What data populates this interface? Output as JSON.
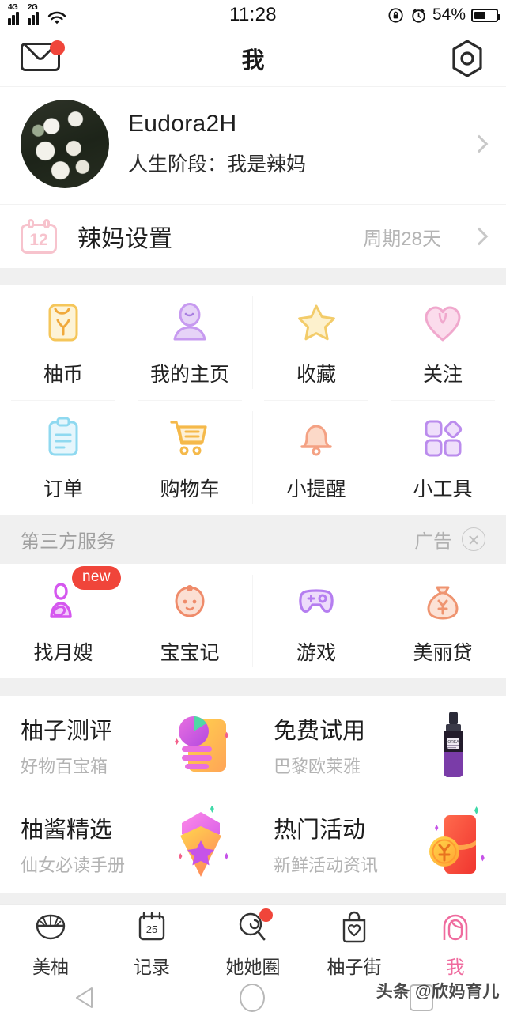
{
  "status_bar": {
    "net1": "4G",
    "net2": "2G",
    "wifi_icon": "wifi-icon",
    "time": "11:28",
    "rotation_lock_icon": "rotation-lock-icon",
    "alarm_icon": "alarm-clock-icon",
    "battery_percent": "54%",
    "battery_icon": "battery-icon"
  },
  "app_bar": {
    "mail_icon": "mail-icon",
    "title": "我",
    "settings_icon": "hex-gear-icon"
  },
  "profile": {
    "avatar": "avatar-flowers",
    "name": "Eudora2H",
    "stage": "人生阶段：我是辣妈",
    "chevron": "chevron-right-icon"
  },
  "settings_row": {
    "icon": "calendar-icon",
    "icon_day": "12",
    "label": "辣妈设置",
    "value": "周期28天",
    "chevron": "chevron-right-icon"
  },
  "grid_row1": [
    {
      "icon": "coin-bag-icon",
      "label": "柚币"
    },
    {
      "icon": "person-icon",
      "label": "我的主页"
    },
    {
      "icon": "star-icon",
      "label": "收藏"
    },
    {
      "icon": "heart-icon",
      "label": "关注"
    }
  ],
  "grid_row2": [
    {
      "icon": "clipboard-icon",
      "label": "订单"
    },
    {
      "icon": "cart-icon",
      "label": "购物车"
    },
    {
      "icon": "bell-icon",
      "label": "小提醒"
    },
    {
      "icon": "tools-grid-icon",
      "label": "小工具"
    }
  ],
  "third_party": {
    "title": "第三方服务",
    "ad_label": "广告",
    "close_icon": "close-circle-icon"
  },
  "grid_row3": [
    {
      "icon": "nanny-icon",
      "label": "找月嫂",
      "badge": "new"
    },
    {
      "icon": "baby-face-icon",
      "label": "宝宝记",
      "badge": ""
    },
    {
      "icon": "gamepad-icon",
      "label": "游戏",
      "badge": ""
    },
    {
      "icon": "money-bag-icon",
      "label": "美丽贷",
      "badge": ""
    }
  ],
  "promo_cards": [
    {
      "title": "柚子测评",
      "subtitle": "好物百宝箱",
      "image": "chart-notebook-image"
    },
    {
      "title": "免费试用",
      "subtitle": "巴黎欧莱雅",
      "image": "serum-bottle-image"
    },
    {
      "title": "柚酱精选",
      "subtitle": "仙女必读手册",
      "image": "gift-gem-image"
    },
    {
      "title": "热门活动",
      "subtitle": "新鲜活动资讯",
      "image": "red-envelope-coin-image"
    }
  ],
  "tab_bar": [
    {
      "icon": "pomelo-icon",
      "label": "美柚",
      "active": false,
      "badge": false
    },
    {
      "icon": "calendar-25-icon",
      "label": "记录",
      "active": false,
      "badge": false
    },
    {
      "icon": "balloon-icon",
      "label": "她她圈",
      "active": false,
      "badge": true
    },
    {
      "icon": "shopping-bag-heart-icon",
      "label": "柚子街",
      "active": false,
      "badge": false
    },
    {
      "icon": "girl-face-icon",
      "label": "我",
      "active": true,
      "badge": false
    }
  ],
  "android_nav": {
    "back_icon": "back-triangle-icon",
    "home_icon": "home-circle-icon",
    "recents_icon": "recents-square-icon"
  },
  "watermark": "头条 @欣妈育儿",
  "colors": {
    "accent_pink": "#ef6b9e",
    "badge_red": "#f0453a",
    "divider_grey": "#f0f0f0",
    "muted_text": "#b3b3b3"
  }
}
